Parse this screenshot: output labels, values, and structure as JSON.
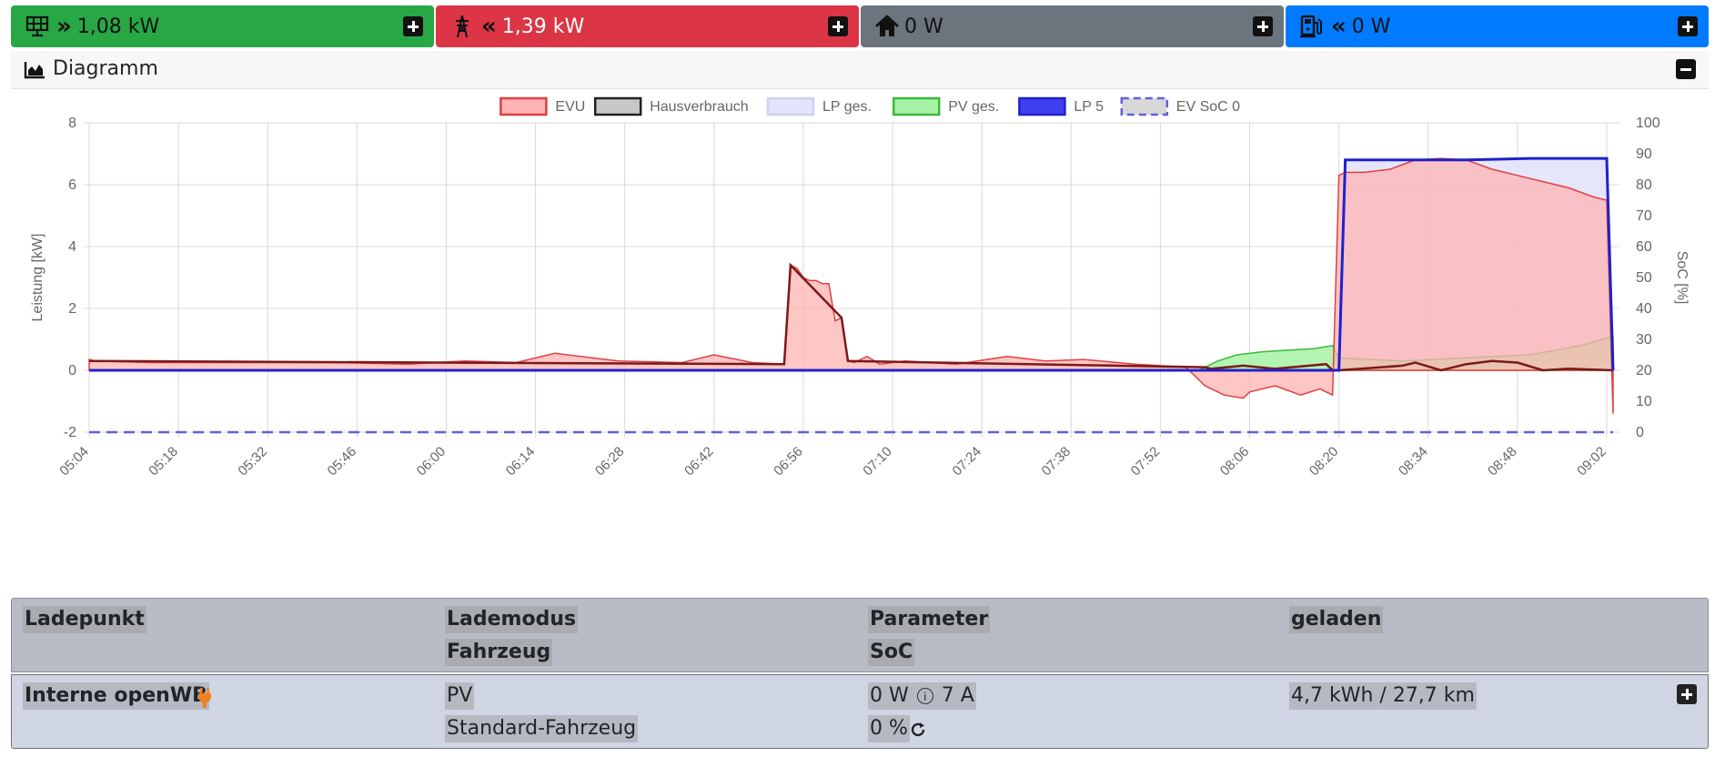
{
  "tiles": {
    "pv": {
      "value": "1,08 kW",
      "icon": "solar-panel-icon",
      "arrow": "chevron-double-right-icon",
      "color": "#28a745"
    },
    "evu": {
      "value": "1,39 kW",
      "icon": "power-tower-icon",
      "arrow": "chevron-double-left-icon",
      "color": "#dc3545"
    },
    "house": {
      "value": "0 W",
      "icon": "home-icon",
      "color": "#6c757d"
    },
    "chargepoint": {
      "value": "0 W",
      "icon": "charging-station-icon",
      "arrow": "chevron-double-left-icon",
      "color": "#007bff"
    }
  },
  "diagram": {
    "title": "Diagramm",
    "icon": "chart-area-icon"
  },
  "chart_data": {
    "type": "area",
    "legend_placement": "top-center",
    "legend": [
      {
        "name": "EVU",
        "fill": "#ffb3b3",
        "stroke": "#e04040",
        "dashed": false
      },
      {
        "name": "Hausverbrauch",
        "fill": "#c8c8c8",
        "stroke": "#222222",
        "dashed": false
      },
      {
        "name": "LP ges.",
        "fill": "#e3e3fb",
        "stroke": "#d0d0f0",
        "dashed": false
      },
      {
        "name": "PV ges.",
        "fill": "#a6f2a6",
        "stroke": "#3cb83c",
        "dashed": false
      },
      {
        "name": "LP 5",
        "fill": "#4040f0",
        "stroke": "#2020cc",
        "dashed": false
      },
      {
        "name": "EV SoC 0",
        "fill": "#d8d8d8",
        "stroke": "#6060dd",
        "dashed": true
      }
    ],
    "ylabel": "Leistung [kW]",
    "y2label": "SoC [%]",
    "ylim": [
      -2,
      8
    ],
    "yticks": [
      "-2",
      "0",
      "2",
      "4",
      "6",
      "8"
    ],
    "y2lim": [
      0,
      100
    ],
    "y2ticks": [
      "0",
      "10",
      "20",
      "30",
      "40",
      "50",
      "60",
      "70",
      "80",
      "90",
      "100"
    ],
    "xlim": [
      "05:04",
      "09:04"
    ],
    "xticks": [
      "05:04",
      "05:18",
      "05:32",
      "05:46",
      "06:00",
      "06:14",
      "06:28",
      "06:42",
      "06:56",
      "07:10",
      "07:24",
      "07:38",
      "07:52",
      "08:06",
      "08:20",
      "08:34",
      "08:48",
      "09:02"
    ],
    "grid": true,
    "series": [
      {
        "name": "EVU",
        "unit": "kW",
        "x": [
          "05:04",
          "05:05",
          "05:14",
          "05:24",
          "05:35",
          "05:43",
          "05:54",
          "06:03",
          "06:11",
          "06:17",
          "06:27",
          "06:37",
          "06:42",
          "06:48",
          "06:53",
          "06:54",
          "06:55",
          "06:56",
          "06:57",
          "06:58",
          "06:59",
          "07:00",
          "07:01",
          "07:02",
          "07:03",
          "07:04",
          "07:06",
          "07:08",
          "07:12",
          "07:20",
          "07:28",
          "07:34",
          "07:40",
          "07:48",
          "07:56",
          "07:59",
          "08:02",
          "08:05",
          "08:06",
          "08:10",
          "08:14",
          "08:17",
          "08:19",
          "08:20",
          "08:21",
          "08:24",
          "08:28",
          "08:32",
          "08:36",
          "08:40",
          "08:44",
          "08:48",
          "08:52",
          "08:56",
          "09:00",
          "09:02",
          "09:03"
        ],
        "values": [
          0.35,
          0.3,
          0.25,
          0.25,
          0.25,
          0.25,
          0.2,
          0.3,
          0.25,
          0.55,
          0.3,
          0.25,
          0.5,
          0.25,
          0.2,
          3.4,
          3.3,
          3.0,
          2.9,
          2.9,
          2.8,
          2.8,
          1.6,
          1.7,
          0.3,
          0.25,
          0.45,
          0.2,
          0.3,
          0.2,
          0.45,
          0.3,
          0.35,
          0.2,
          0.1,
          -0.5,
          -0.8,
          -0.9,
          -0.7,
          -0.5,
          -0.8,
          -0.6,
          -0.8,
          6.3,
          6.4,
          6.4,
          6.5,
          6.8,
          6.85,
          6.8,
          6.5,
          6.3,
          6.1,
          5.9,
          5.6,
          5.5,
          -1.4
        ]
      },
      {
        "name": "Hausverbrauch",
        "unit": "kW",
        "x": [
          "05:04",
          "06:53",
          "06:54",
          "07:02",
          "07:03",
          "07:59",
          "08:00",
          "08:05",
          "08:10",
          "08:18",
          "08:19",
          "08:20",
          "08:30",
          "08:32",
          "08:36",
          "08:40",
          "08:44",
          "08:48",
          "08:52",
          "08:56",
          "09:03"
        ],
        "values": [
          0.3,
          0.2,
          3.4,
          1.7,
          0.3,
          0.1,
          0.05,
          0.15,
          0.05,
          0.2,
          0.0,
          0.0,
          0.15,
          0.25,
          0.0,
          0.2,
          0.3,
          0.25,
          0.0,
          0.05,
          0.0
        ]
      },
      {
        "name": "LP ges.",
        "unit": "kW",
        "x": [
          "05:04",
          "08:20",
          "08:21",
          "08:40",
          "08:50",
          "09:02",
          "09:03"
        ],
        "values": [
          0,
          0,
          6.8,
          6.8,
          6.85,
          6.85,
          0
        ]
      },
      {
        "name": "PV ges.",
        "unit": "kW",
        "x": [
          "05:04",
          "07:58",
          "08:01",
          "08:04",
          "08:08",
          "08:12",
          "08:16",
          "08:19",
          "08:20",
          "08:30",
          "08:40",
          "08:50",
          "08:58",
          "09:03"
        ],
        "values": [
          0,
          0,
          0.3,
          0.5,
          0.6,
          0.65,
          0.7,
          0.8,
          0.4,
          0.3,
          0.4,
          0.5,
          0.8,
          1.1
        ]
      },
      {
        "name": "LP 5",
        "unit": "kW",
        "x": [
          "05:04",
          "08:20",
          "08:21",
          "08:40",
          "08:50",
          "09:02",
          "09:03"
        ],
        "values": [
          0,
          0,
          6.8,
          6.8,
          6.85,
          6.85,
          0
        ]
      },
      {
        "name": "EV SoC 0",
        "unit": "%",
        "x": [
          "05:04",
          "09:03"
        ],
        "values": [
          0,
          0
        ]
      }
    ]
  },
  "table": {
    "headers": {
      "ladepunkt": "Ladepunkt",
      "lademodus": "Lademodus",
      "fahrzeug": "Fahrzeug",
      "parameter": "Parameter",
      "soc": "SoC",
      "geladen": "geladen"
    },
    "row": {
      "name": "Interne openWB",
      "plug_icon": "plug-icon",
      "mode": "PV",
      "vehicle": "Standard-Fahrzeug",
      "power": "0 W",
      "info_icon": "info-icon",
      "current": "7 A",
      "soc": "0 %",
      "refresh_icon": "refresh-icon",
      "charged": "4,7 kWh / 27,7 km"
    }
  }
}
